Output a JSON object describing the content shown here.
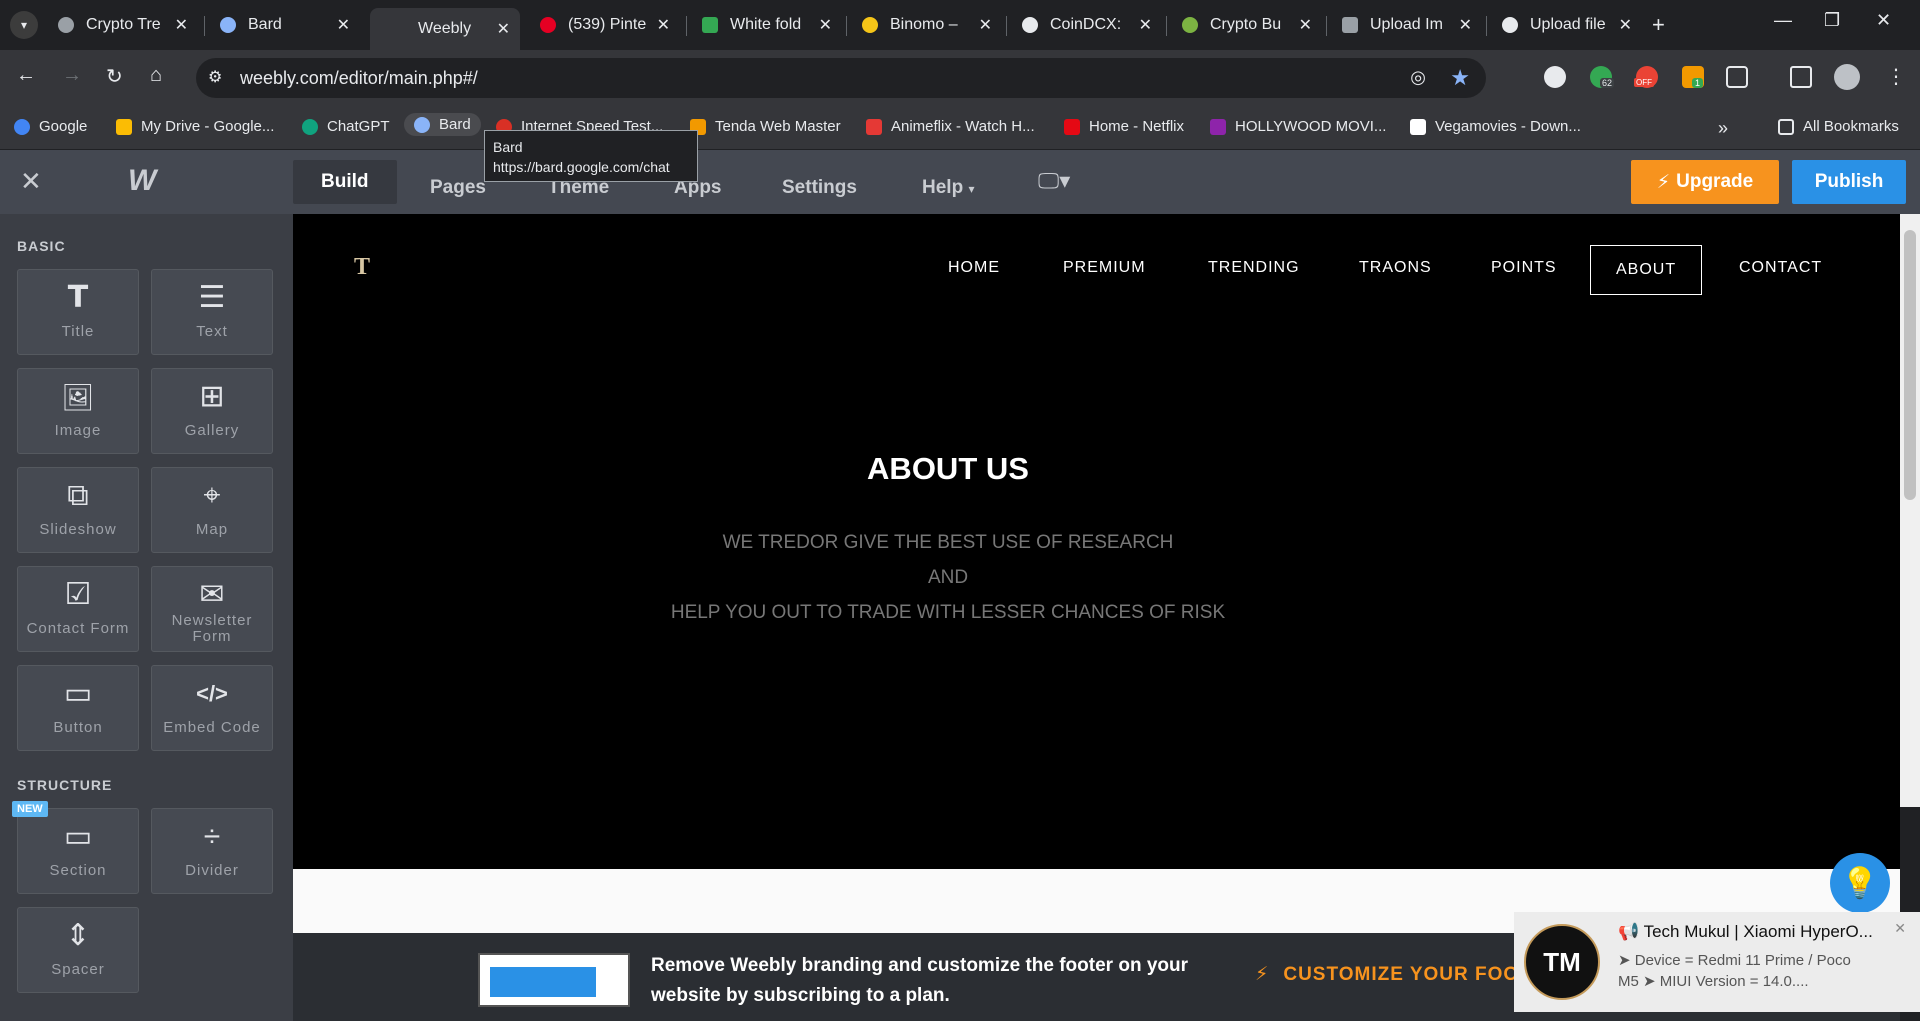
{
  "browser": {
    "tabs": [
      {
        "title": "Crypto Tre",
        "favicon_color": "#9aa0a6"
      },
      {
        "title": "Bard",
        "favicon_color": "#8ab4f8"
      },
      {
        "title": "Weebly",
        "favicon_color": "#35363a"
      },
      {
        "title": "(539) Pinte",
        "favicon_color": "#e60023"
      },
      {
        "title": "White fold",
        "favicon_color": "#34a853"
      },
      {
        "title": "Binomo –",
        "favicon_color": "#f5c518"
      },
      {
        "title": "CoinDCX:",
        "favicon_color": "#e8eaed"
      },
      {
        "title": "Crypto Bu",
        "favicon_color": "#7cb342"
      },
      {
        "title": "Upload Im",
        "favicon_color": "#9aa0a6"
      },
      {
        "title": "Upload file",
        "favicon_color": "#e8eaed"
      }
    ],
    "url": "weebly.com/editor/main.php#/",
    "bookmarks": [
      {
        "label": "Google",
        "color": "#4285f4"
      },
      {
        "label": "My Drive - Google...",
        "color": "#fbbc04"
      },
      {
        "label": "ChatGPT",
        "color": "#10a37f"
      },
      {
        "label": "Bard",
        "color": "#8ab4f8"
      },
      {
        "label": "Internet Speed Test...",
        "color": "#d93025"
      },
      {
        "label": "Tenda Web Master",
        "color": "#f29900"
      },
      {
        "label": "Animeflix - Watch H...",
        "color": "#e53935"
      },
      {
        "label": "Home - Netflix",
        "color": "#e50914"
      },
      {
        "label": "HOLLYWOOD MOVI...",
        "color": "#8e24aa"
      },
      {
        "label": "Vegamovies - Down...",
        "color": "#ffffff"
      }
    ],
    "all_bookmarks": "All Bookmarks",
    "tooltip": {
      "title": "Bard",
      "url": "https://bard.google.com/chat"
    },
    "ext_badge_62": "62",
    "ext_badge_off": "OFF",
    "ext_badge_1": "1"
  },
  "editor": {
    "nav": [
      "Build",
      "Pages",
      "Theme",
      "Apps",
      "Settings",
      "Help"
    ],
    "upgrade_label": "Upgrade",
    "publish_label": "Publish",
    "sidebar": {
      "basic_label": "BASIC",
      "structure_label": "STRUCTURE",
      "new_badge": "NEW",
      "basic_items": [
        {
          "label": "Title",
          "icon": "T"
        },
        {
          "label": "Text",
          "icon": "☰"
        },
        {
          "label": "Image",
          "icon": "🖼"
        },
        {
          "label": "Gallery",
          "icon": "⊞"
        },
        {
          "label": "Slideshow",
          "icon": "⧉"
        },
        {
          "label": "Map",
          "icon": "⌖"
        },
        {
          "label": "Contact Form",
          "icon": "☑"
        },
        {
          "label": "Newsletter Form",
          "icon": "✉"
        },
        {
          "label": "Button",
          "icon": "▭"
        },
        {
          "label": "Embed Code",
          "icon": "</>"
        }
      ],
      "structure_items": [
        {
          "label": "Section",
          "icon": "▭"
        },
        {
          "label": "Divider",
          "icon": "÷"
        },
        {
          "label": "Spacer",
          "icon": "⇕"
        }
      ]
    }
  },
  "site": {
    "logo": "T",
    "menu": [
      "HOME",
      "PREMIUM",
      "TRENDING",
      "TRAONS",
      "POINTS",
      "ABOUT",
      "CONTACT"
    ],
    "active_menu": "ABOUT",
    "heading": "ABOUT US",
    "lines": [
      "WE TREDOR GIVE THE BEST USE OF RESEARCH",
      "AND",
      "HELP YOU OUT TO TRADE WITH LESSER CHANCES OF RISK"
    ]
  },
  "footer_banner": {
    "text": "Remove Weebly branding and customize the footer on your website by subscribing to a plan.",
    "cta": "CUSTOMIZE YOUR FOOTER"
  },
  "notification": {
    "avatar": "TM",
    "title": "📢 Tech Mukul | Xiaomi HyperO...",
    "body": "➤ Device = Redmi 11 Prime / Poco M5 ➤ MIUI Version = 14.0...."
  }
}
